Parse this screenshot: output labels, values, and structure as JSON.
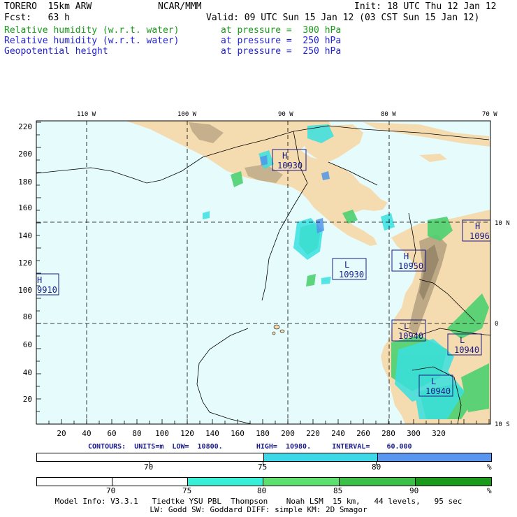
{
  "header": {
    "model": "TORERO  15km ARW",
    "center": "NCAR/MMM",
    "init": "Init: 18 UTC Thu 12 Jan 12",
    "fcst": "Fcst:   63 h",
    "valid": "Valid: 09 UTC Sun 15 Jan 12 (03 CST Sun 15 Jan 12)",
    "fields": [
      {
        "name": "Relative humidity (w.r.t. water)",
        "level": "at pressure =  300 hPa",
        "color": "#1a9a1a"
      },
      {
        "name": "Relative humidity (w.r.t. water)",
        "level": "at pressure =  250 hPa",
        "color": "#1f1fd0"
      },
      {
        "name": "Geopotential height",
        "level": "at pressure =  250 hPa",
        "color": "#1f1fd0"
      }
    ]
  },
  "map": {
    "longitude_labels": [
      "110 W",
      "100 W",
      "90 W",
      "80 W",
      "70 W"
    ],
    "latitude_labels": [
      "10 N",
      "0",
      "10 S"
    ],
    "x_ticks": [
      "20",
      "40",
      "60",
      "80",
      "100",
      "120",
      "140",
      "160",
      "180",
      "200",
      "220",
      "240",
      "260",
      "280",
      "300",
      "320"
    ],
    "y_ticks": [
      "220",
      "200",
      "180",
      "160",
      "140",
      "120",
      "100",
      "80",
      "60",
      "40",
      "20"
    ],
    "pressure_centers": [
      {
        "type": "H",
        "value": "10930"
      },
      {
        "type": "H",
        "value": "10950"
      },
      {
        "type": "H",
        "value": "1096"
      },
      {
        "type": "H",
        "value": "9910"
      },
      {
        "type": "L",
        "value": "10930"
      },
      {
        "type": "L",
        "value": "10940"
      },
      {
        "type": "L",
        "value": "10940"
      },
      {
        "type": "L",
        "value": "10940"
      }
    ],
    "colors": {
      "ocean": "#e6fcfc",
      "land": "#f5dcb0",
      "terrain": "#9c8c70",
      "humid_green": "#4cd070",
      "humid_cyan": "#38e0e0",
      "humid_blue": "#5096e8"
    }
  },
  "contours": {
    "label": "CONTOURS:  UNITS=m  LOW=  10800.        HIGH=  10980.     INTERVAL=    60.000"
  },
  "colorbar_250": {
    "labels": [
      "70",
      "75",
      "80",
      "%"
    ],
    "colors": [
      "#ffffff",
      "#3cd8e8",
      "#5896f0"
    ]
  },
  "colorbar_300": {
    "labels": [
      "70",
      "75",
      "80",
      "85",
      "90",
      "%"
    ],
    "colors": [
      "#ffffff",
      "#ffffff",
      "#38f0d8",
      "#5ce070",
      "#3cc048",
      "#1a9a1a"
    ]
  },
  "footer": {
    "line1": "Model Info: V3.3.1   Tiedtke YSU PBL  Thompson    Noah LSM  15 km,   44 levels,   95 sec",
    "line2": "LW: Godd SW: Goddard DIFF: simple KM: 2D Smagor"
  }
}
